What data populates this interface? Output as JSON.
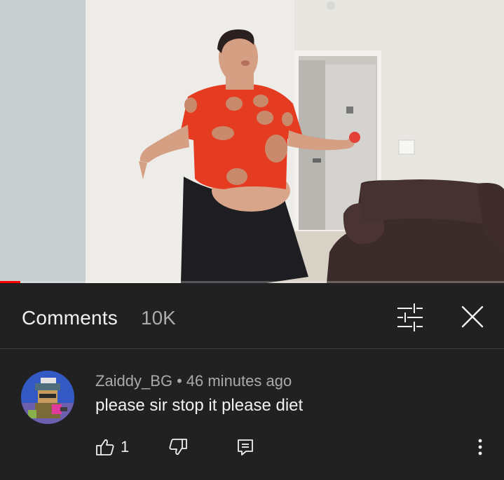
{
  "video": {
    "progress_fraction": 0.04
  },
  "comments_panel": {
    "title": "Comments",
    "count": "10K",
    "filter_icon": "sliders-icon",
    "close_icon": "close-icon"
  },
  "comment": {
    "author": "Zaiddy_BG",
    "separator": "•",
    "time": "46 minutes ago",
    "text": "please sir stop it please diet",
    "like_count": "1",
    "icons": {
      "like": "thumbs-up-icon",
      "dislike": "thumbs-down-icon",
      "reply": "reply-icon",
      "more": "more-vertical-icon"
    }
  },
  "colors": {
    "background": "#212121",
    "text_primary": "#f1f1f1",
    "text_secondary": "#aaaaaa",
    "progress": "#ff0000"
  }
}
